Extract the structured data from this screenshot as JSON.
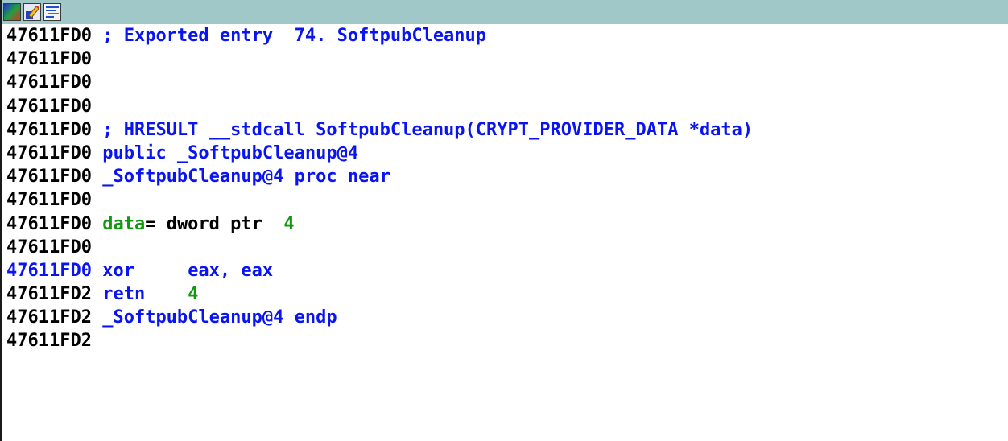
{
  "toolbar": {
    "icons": [
      {
        "name": "graph-view-icon"
      },
      {
        "name": "edit-pencil-icon"
      },
      {
        "name": "text-view-icon"
      }
    ]
  },
  "colors": {
    "title_bar": "#a0c8c8",
    "blue": "#0a14f0",
    "black": "#000000",
    "green": "#119a11"
  },
  "lines": [
    {
      "addr": "47611FD0",
      "segments": [
        {
          "text": " ; Exported entry  74. SoftpubCleanup",
          "color": "blue"
        }
      ]
    },
    {
      "addr": "47611FD0",
      "segments": []
    },
    {
      "addr": "47611FD0",
      "segments": []
    },
    {
      "addr": "47611FD0",
      "segments": []
    },
    {
      "addr": "47611FD0",
      "segments": [
        {
          "text": " ; HRESULT __stdcall SoftpubCleanup(CRYPT_PROVIDER_DATA *data)",
          "color": "blue"
        }
      ]
    },
    {
      "addr": "47611FD0",
      "segments": [
        {
          "text": " public _SoftpubCleanup@4",
          "color": "blue"
        }
      ]
    },
    {
      "addr": "47611FD0",
      "segments": [
        {
          "text": " _SoftpubCleanup@4 proc near",
          "color": "blue"
        }
      ]
    },
    {
      "addr": "47611FD0",
      "segments": []
    },
    {
      "addr": "47611FD0",
      "segments": [
        {
          "text": " data",
          "color": "green"
        },
        {
          "text": "= dword ptr  ",
          "color": "black"
        },
        {
          "text": "4",
          "color": "green"
        }
      ]
    },
    {
      "addr": "47611FD0",
      "segments": []
    },
    {
      "addr": "47611FD0",
      "highlight": true,
      "segments": [
        {
          "text": " xor     ",
          "color": "blue"
        },
        {
          "text": "eax, eax",
          "color": "blue"
        }
      ]
    },
    {
      "addr": "47611FD2",
      "segments": [
        {
          "text": " retn    ",
          "color": "blue"
        },
        {
          "text": "4",
          "color": "green"
        }
      ]
    },
    {
      "addr": "47611FD2",
      "segments": [
        {
          "text": " _SoftpubCleanup@4 endp",
          "color": "blue"
        }
      ]
    },
    {
      "addr": "47611FD2",
      "segments": []
    }
  ]
}
